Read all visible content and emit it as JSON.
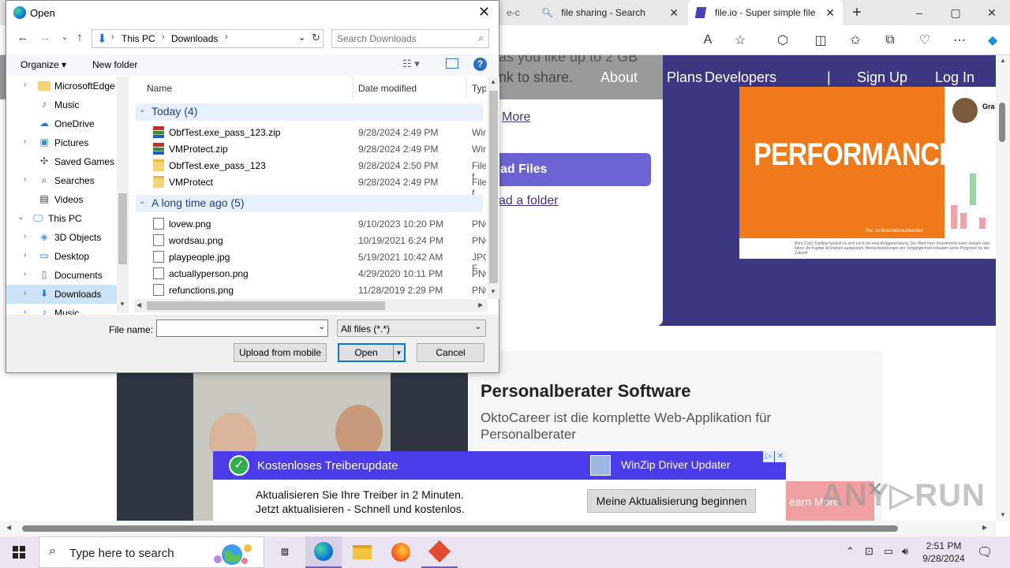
{
  "browser": {
    "tabs": [
      {
        "label": "e-c",
        "active": false
      },
      {
        "label": "file sharing - Search",
        "active": false
      },
      {
        "label": "file.io - Super simple file",
        "active": true
      }
    ],
    "new_tab": "+",
    "controls": {
      "minimize": "–",
      "maximize": "▢",
      "close": "✕"
    }
  },
  "site": {
    "nav": [
      "About",
      "Plans",
      "Developers",
      "Sign Up",
      "Log In"
    ],
    "nav_divider": "|",
    "hero_line1": "as you like up to 2 GB",
    "hero_line2": "nk to share.",
    "more_link": "More",
    "upload_button": "ad Files",
    "folder_link": "ad a folder",
    "promo_title": "PERFORMANCES",
    "promo_name": "Gra",
    "promo_note": "Born Copy Trading handelt es sich nicht um eine Anlageberatung. Der Wert Ihrer Investments kann steigen oder fallen. Ihr Kapital ist Risiken ausgesetzt. Wertentwicklungen der Vergangenheit erlauben keine Prognose für die Zukunft",
    "promo_caption": "Nur zu Illustrationszwecken",
    "section_title": "Personalberater Software",
    "section_text": "OktoCareer ist die komplette Web-Applikation für Personalberater",
    "learn_more": "earn More"
  },
  "ad": {
    "title": "Kostenloses Treiberupdate",
    "brand": "WinZip Driver Updater",
    "line1": "Aktualisieren Sie Ihre Treiber in 2 Minuten.",
    "line2": "Jetzt aktualisieren - Schnell und kostenlos.",
    "cta": "Meine Aktualisierung beginnen"
  },
  "watermark": "ANY▷RUN",
  "dialog": {
    "title": "Open",
    "breadcrumb": [
      "This PC",
      "Downloads"
    ],
    "search_placeholder": "Search Downloads",
    "organize": "Organize ▾",
    "new_folder": "New folder",
    "tree": [
      {
        "label": "MicrosoftEdge",
        "icon": "folder-icon",
        "expandable": true
      },
      {
        "label": "Music",
        "icon": "music-icon",
        "expandable": false
      },
      {
        "label": "OneDrive",
        "icon": "cloud-icon",
        "expandable": false
      },
      {
        "label": "Pictures",
        "icon": "pictures-icon",
        "expandable": true
      },
      {
        "label": "Saved Games",
        "icon": "games-icon",
        "expandable": false
      },
      {
        "label": "Searches",
        "icon": "search-icon",
        "expandable": true
      },
      {
        "label": "Videos",
        "icon": "videos-icon",
        "expandable": false
      },
      {
        "label": "This PC",
        "icon": "pc-icon",
        "expandable": true
      },
      {
        "label": "3D Objects",
        "icon": "cube-icon",
        "expandable": true
      },
      {
        "label": "Desktop",
        "icon": "desktop-icon",
        "expandable": true
      },
      {
        "label": "Documents",
        "icon": "documents-icon",
        "expandable": true
      },
      {
        "label": "Downloads",
        "icon": "downloads-icon",
        "expandable": true,
        "selected": true
      },
      {
        "label": "Music",
        "icon": "music-icon",
        "expandable": true
      }
    ],
    "columns": [
      "Name",
      "Date modified",
      "Type"
    ],
    "groups": [
      {
        "label": "Today (4)",
        "files": [
          {
            "name": "ObfTest.exe_pass_123.zip",
            "date": "9/28/2024 2:49 PM",
            "type": "WinR",
            "icon": "zip"
          },
          {
            "name": "VMProtect.zip",
            "date": "9/28/2024 2:49 PM",
            "type": "WinR",
            "icon": "zip"
          },
          {
            "name": "ObfTest.exe_pass_123",
            "date": "9/28/2024 2:50 PM",
            "type": "File f",
            "icon": "folder"
          },
          {
            "name": "VMProtect",
            "date": "9/28/2024 2:49 PM",
            "type": "File f",
            "icon": "folder"
          }
        ]
      },
      {
        "label": "A long time ago (5)",
        "files": [
          {
            "name": "lovew.png",
            "date": "9/10/2023 10:20 PM",
            "type": "PNG",
            "icon": "file"
          },
          {
            "name": "wordsau.png",
            "date": "10/19/2021 6:24 PM",
            "type": "PNG",
            "icon": "file"
          },
          {
            "name": "playpeople.jpg",
            "date": "5/19/2021 10:42 AM",
            "type": "JPG F",
            "icon": "file"
          },
          {
            "name": "actuallyperson.png",
            "date": "4/29/2020 10:11 PM",
            "type": "PNG",
            "icon": "file"
          },
          {
            "name": "refunctions.png",
            "date": "11/28/2019 2:29 PM",
            "type": "PNG",
            "icon": "file"
          }
        ]
      }
    ],
    "file_name_label": "File name:",
    "file_name_value": "",
    "file_type": "All files (*.*)",
    "upload_mobile": "Upload from mobile",
    "open": "Open",
    "cancel": "Cancel"
  },
  "taskbar": {
    "search_placeholder": "Type here to search",
    "time": "2:51 PM",
    "date": "9/28/2024"
  },
  "colors": {
    "hero": "#3d3680",
    "accent_button": "#6b63d4",
    "promo_orange": "#f07a1a",
    "ad_bar": "#4a3ce8",
    "selection": "#cce4f7",
    "group_header_text": "#1e3f8a"
  }
}
